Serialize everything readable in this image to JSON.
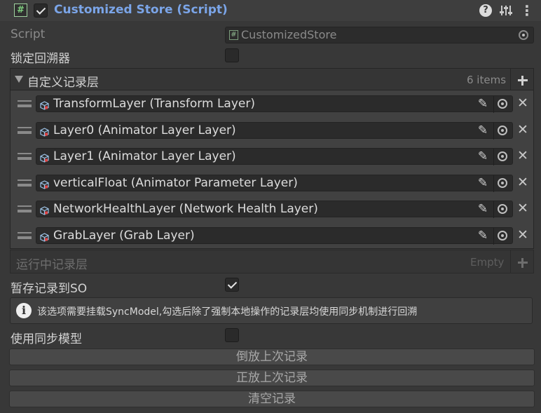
{
  "header": {
    "title": "Customized Store (Script)",
    "enabled": true,
    "help_icon": "?",
    "settings_icon": "⊥",
    "menu_icon": "⋮"
  },
  "script_field": {
    "label": "Script",
    "value": "CustomizedStore"
  },
  "lock_rollback": {
    "label": "锁定回溯器",
    "checked": false
  },
  "custom_layers": {
    "label": "自定义记录层",
    "count_text": "6 items",
    "items": [
      {
        "text": "TransformLayer (Transform Layer)"
      },
      {
        "text": "Layer0 (Animator Layer Layer)"
      },
      {
        "text": "Layer1 (Animator Layer Layer)"
      },
      {
        "text": "verticalFloat (Animator Parameter Layer)"
      },
      {
        "text": "NetworkHealthLayer (Network Health Layer)"
      },
      {
        "text": "GrabLayer (Grab Layer)"
      }
    ]
  },
  "runtime_layers": {
    "label": "运行中记录层",
    "count_text": "Empty"
  },
  "save_to_so": {
    "label": "暂存记录到SO",
    "checked": true
  },
  "help_box": {
    "text": "该选项需要挂载SyncModel,勾选后除了强制本地操作的记录层均使用同步机制进行回溯"
  },
  "use_sync_model": {
    "label": "使用同步模型",
    "checked": false
  },
  "buttons": {
    "rewind": "倒放上次记录",
    "forward": "正放上次记录",
    "clear": "清空记录"
  },
  "icons": {
    "header": [
      "hash-script-icon",
      "help-icon",
      "presets-icon",
      "kebab-menu-icon"
    ],
    "row": [
      "drag-handle-icon",
      "cube-icon",
      "pencil-icon",
      "object-picker-icon",
      "remove-x-icon"
    ]
  },
  "colors": {
    "title": "#7ba5e8",
    "background": "#383838",
    "field": "#2b2b2b"
  }
}
